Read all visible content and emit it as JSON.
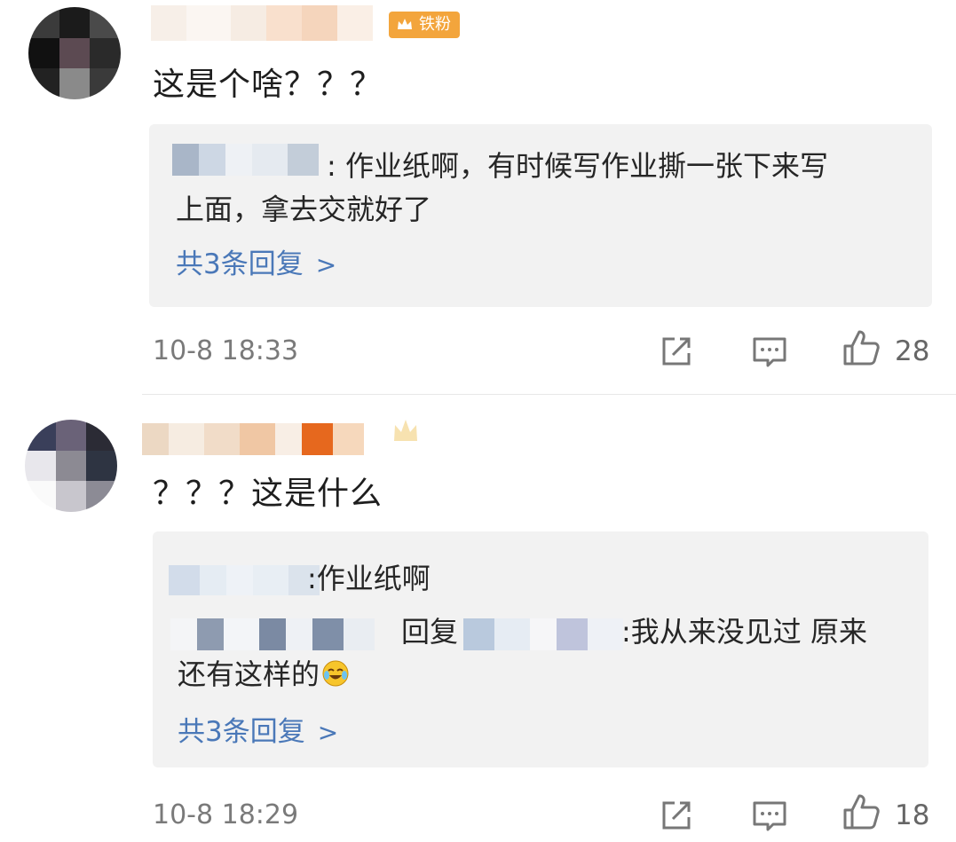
{
  "comments": [
    {
      "content": "这是个啥？？？",
      "badge": "铁粉",
      "replies": [
        {
          "separator": ":",
          "text_line1": "作业纸啊，有时候写作业撕一张下来写",
          "text_line2": "上面，拿去交就好了"
        }
      ],
      "more_replies": "共3条回复",
      "time": "10-8 18:33",
      "likes": "28"
    },
    {
      "content": "？？？这是什么",
      "replies": [
        {
          "separator": ":",
          "text_line1": "作业纸啊"
        },
        {
          "reply_word": "回复",
          "separator": ":",
          "text_line1": "我从来没见过 原来",
          "text_line2": "还有这样的"
        }
      ],
      "more_replies": "共3条回复",
      "time": "10-8 18:29",
      "likes": "18"
    }
  ],
  "icons": {
    "share": "share-icon",
    "comment": "comment-icon",
    "like": "thumbs-up-icon",
    "badge": "crown-icon",
    "emoji": "laughing-crying-emoji-icon",
    "chevron": "chevron-right-icon"
  },
  "colors": {
    "link": "#4a78b8",
    "badge": "#f3a53c",
    "reply_bg": "#f2f2f2",
    "meta": "#7a7a7a"
  }
}
